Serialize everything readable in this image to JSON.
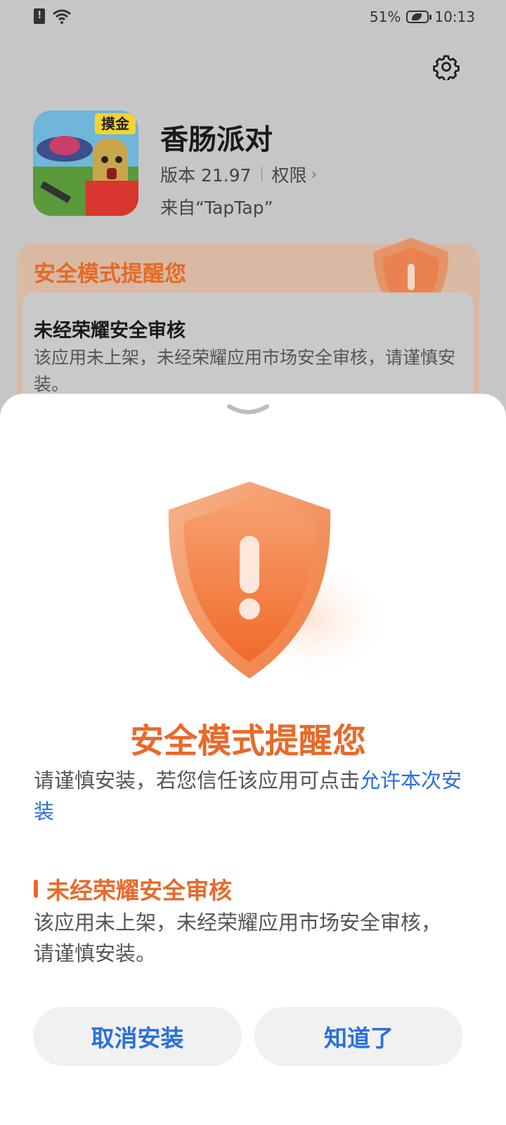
{
  "status_bar": {
    "battery": "51%",
    "time": "10:13"
  },
  "app": {
    "name": "香肠派对",
    "version": "版本 21.97",
    "permissions": "权限",
    "source": "来自“TapTap”",
    "icon_badge": "摸金"
  },
  "background_card": {
    "title": "安全模式提醒您",
    "item_title": "未经荣耀安全审核",
    "item_desc": "该应用未上架，未经荣耀应用市场安全审核，请谨慎安装。"
  },
  "sheet": {
    "title": "安全模式提醒您",
    "desc_prefix": "请谨慎安装，若您信任该应用可点击",
    "desc_link": "允许本次安装",
    "section_title": "未经荣耀安全审核",
    "section_desc": "该应用未上架，未经荣耀应用市场安全审核，请谨慎安装。",
    "cancel_button": "取消安装",
    "ok_button": "知道了"
  },
  "colors": {
    "accent_orange": "#e8692a",
    "link_blue": "#2a6fdc"
  }
}
